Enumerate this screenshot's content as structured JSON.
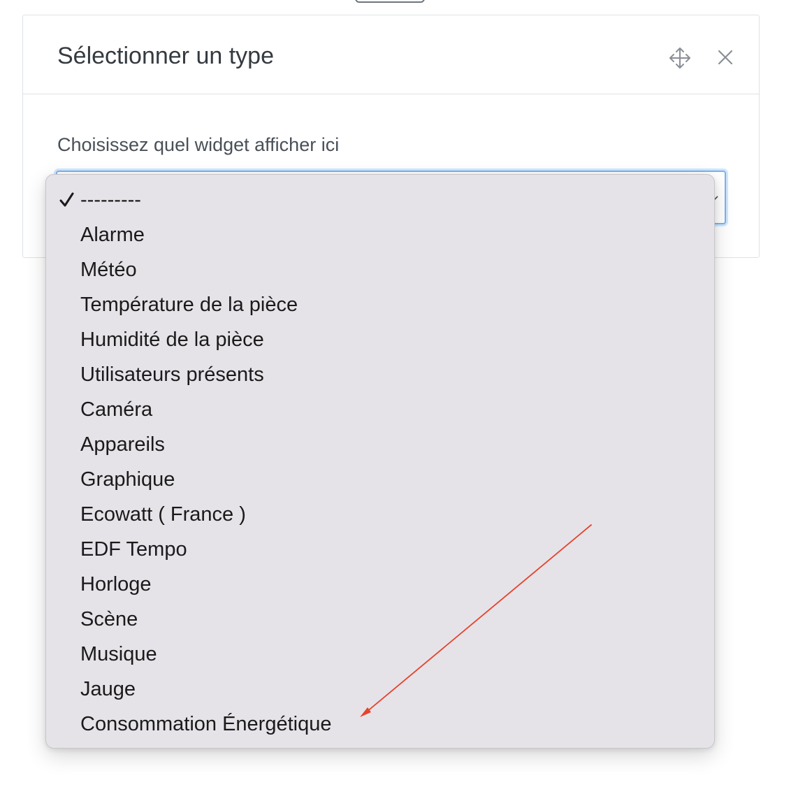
{
  "modal": {
    "title": "Sélectionner un type",
    "move_icon": "move-icon",
    "close_icon": "close-icon"
  },
  "form": {
    "label": "Choisissez quel widget afficher ici",
    "select": {
      "selected_index": 0,
      "options": [
        "---------",
        "Alarme",
        "Météo",
        "Température de la pièce",
        "Humidité de la pièce",
        "Utilisateurs présents",
        "Caméra",
        "Appareils",
        "Graphique",
        "Ecowatt ( France )",
        "EDF Tempo",
        "Horloge",
        "Scène",
        "Musique",
        "Jauge",
        "Consommation Énergétique"
      ]
    }
  },
  "colors": {
    "focus_border": "#7cb3ea",
    "dropdown_bg": "#e6e3e8",
    "annotation_arrow": "#e5432d"
  }
}
